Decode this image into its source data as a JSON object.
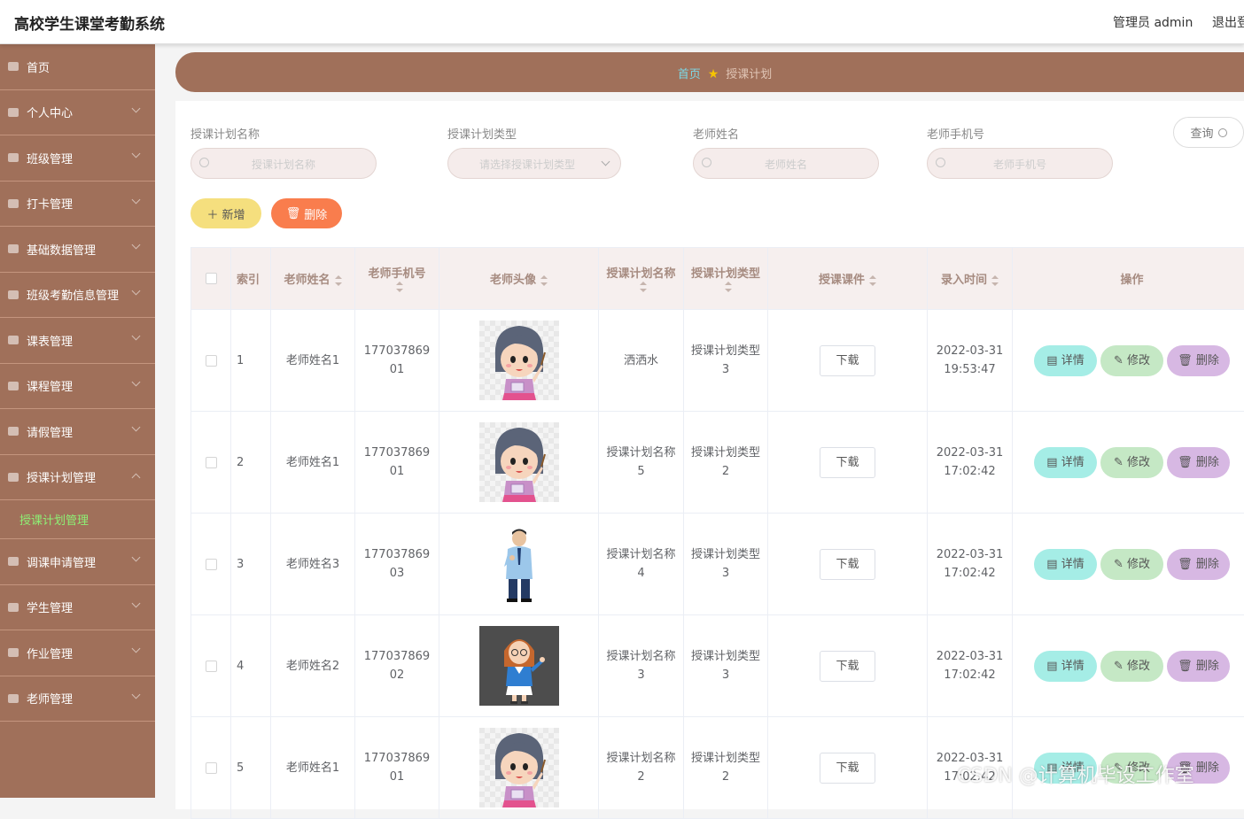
{
  "header": {
    "app_title": "高校学生课堂考勤系统",
    "admin_label": "管理员 admin",
    "logout_label": "退出登录"
  },
  "sidebar": {
    "items": [
      {
        "label": "首页",
        "icon": "home-icon"
      },
      {
        "label": "个人中心",
        "icon": "user-icon"
      },
      {
        "label": "班级管理",
        "icon": "send-icon"
      },
      {
        "label": "打卡管理",
        "icon": "menu-icon"
      },
      {
        "label": "基础数据管理",
        "icon": "message-icon"
      },
      {
        "label": "班级考勤信息管理",
        "icon": "fullscreen-icon"
      },
      {
        "label": "课表管理",
        "icon": "layers-icon"
      },
      {
        "label": "课程管理",
        "icon": "power-icon"
      },
      {
        "label": "请假管理",
        "icon": "phone-icon"
      },
      {
        "label": "授课计划管理",
        "icon": "document-icon",
        "submenu": [
          "授课计划管理"
        ]
      },
      {
        "label": "调课申请管理",
        "icon": "bar-chart-icon"
      },
      {
        "label": "学生管理",
        "icon": "monitor-icon"
      },
      {
        "label": "作业管理",
        "icon": "copy-icon"
      },
      {
        "label": "老师管理",
        "icon": "video-icon"
      }
    ]
  },
  "breadcrumb": {
    "home": "首页",
    "current": "授课计划"
  },
  "filters": [
    {
      "label": "授课计划名称",
      "placeholder": "授课计划名称",
      "type": "input"
    },
    {
      "label": "授课计划类型",
      "placeholder": "请选择授课计划类型",
      "type": "select"
    },
    {
      "label": "老师姓名",
      "placeholder": "老师姓名",
      "type": "input"
    },
    {
      "label": "老师手机号",
      "placeholder": "老师手机号",
      "type": "input"
    }
  ],
  "actions": {
    "query": "查询",
    "add": "新增",
    "delete": "删除"
  },
  "table": {
    "columns": [
      "索引",
      "老师姓名",
      "老师手机号",
      "老师头像",
      "授课计划名称",
      "授课计划类型",
      "授课课件",
      "录入时间",
      "操作"
    ],
    "download_label": "下载",
    "op_labels": {
      "detail": "详情",
      "edit": "修改",
      "delete": "删除"
    },
    "rows": [
      {
        "index": "1",
        "teacher_name": "老师姓名1",
        "phone": "17703786901",
        "avatar": "female-teacher-cartoon",
        "plan_name": "洒洒水",
        "plan_type": "授课计划类型3",
        "time": "2022-03-31 19:53:47"
      },
      {
        "index": "2",
        "teacher_name": "老师姓名1",
        "phone": "17703786901",
        "avatar": "female-teacher-cartoon",
        "plan_name": "授课计划名称5",
        "plan_type": "授课计划类型2",
        "time": "2022-03-31 17:02:42"
      },
      {
        "index": "3",
        "teacher_name": "老师姓名3",
        "phone": "17703786903",
        "avatar": "male-teacher-photo",
        "plan_name": "授课计划名称4",
        "plan_type": "授课计划类型3",
        "time": "2022-03-31 17:02:42"
      },
      {
        "index": "4",
        "teacher_name": "老师姓名2",
        "phone": "17703786902",
        "avatar": "female-teacher-glasses",
        "plan_name": "授课计划名称3",
        "plan_type": "授课计划类型3",
        "time": "2022-03-31 17:02:42"
      },
      {
        "index": "5",
        "teacher_name": "老师姓名1",
        "phone": "17703786901",
        "avatar": "female-teacher-cartoon",
        "plan_name": "授课计划名称2",
        "plan_type": "授课计划类型2",
        "time": "2022-03-31 17:02:42"
      }
    ]
  },
  "watermark": "CSDN @计算机毕设工作室",
  "colors": {
    "sidebar": "#a0705a",
    "active_submenu": "#8ef075",
    "breadcrumb_home": "#7dd8e6",
    "add_button": "#f5df7e",
    "delete_button": "#f97d4d",
    "detail_button": "#a5ede6",
    "edit_button": "#c5e8c5",
    "row_delete_button": "#d7b8e3"
  }
}
